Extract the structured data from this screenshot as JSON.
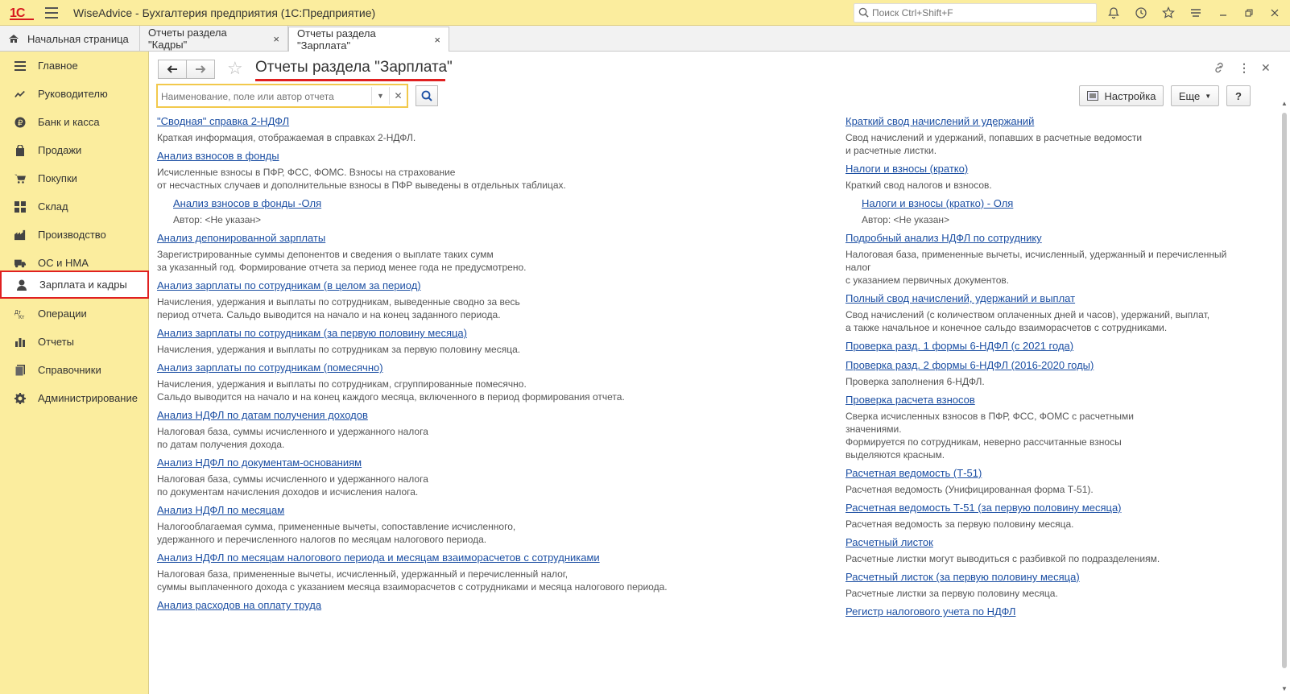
{
  "app": {
    "logo": "1С",
    "title": "WiseAdvice - Бухгалтерия предприятия  (1С:Предприятие)"
  },
  "search": {
    "placeholder": "Поиск Ctrl+Shift+F"
  },
  "tabs": [
    {
      "label": "Начальная страница"
    },
    {
      "label": "Отчеты раздела \"Кадры\"",
      "close": "×"
    },
    {
      "label": "Отчеты раздела \"Зарплата\"",
      "close": "×"
    }
  ],
  "sidebar": {
    "items": [
      {
        "label": "Главное",
        "icon": "menu-icon"
      },
      {
        "label": "Руководителю",
        "icon": "trend-icon"
      },
      {
        "label": "Банк и касса",
        "icon": "ruble-icon"
      },
      {
        "label": "Продажи",
        "icon": "bag-icon"
      },
      {
        "label": "Покупки",
        "icon": "cart-icon"
      },
      {
        "label": "Склад",
        "icon": "grid-icon"
      },
      {
        "label": "Производство",
        "icon": "factory-icon"
      },
      {
        "label": "ОС и НМА",
        "icon": "truck-icon"
      },
      {
        "label": "Зарплата и кадры",
        "icon": "person-icon",
        "active": true
      },
      {
        "label": "Операции",
        "icon": "operations-icon"
      },
      {
        "label": "Отчеты",
        "icon": "barchart-icon"
      },
      {
        "label": "Справочники",
        "icon": "book-icon"
      },
      {
        "label": "Администрирование",
        "icon": "gear-icon"
      }
    ]
  },
  "main": {
    "title": "Отчеты раздела \"Зарплата\"",
    "filter_placeholder": "Наименование, поле или автор отчета",
    "settings_label": "Настройка",
    "more_label": "Еще",
    "help_label": "?",
    "left": [
      {
        "link": "\"Сводная\" справка 2-НДФЛ",
        "desc": "Краткая информация, отображаемая в справках 2-НДФЛ."
      },
      {
        "link": "Анализ взносов в фонды",
        "desc": "Исчисленные взносы в ПФР, ФСС, ФОМС. Взносы на страхование\nот несчастных случаев и дополнительные взносы в ПФР выведены в отдельных таблицах."
      },
      {
        "link": "Анализ взносов в фонды -Оля",
        "desc": "Автор: <Не указан>",
        "sub": true
      },
      {
        "link": "Анализ депонированной зарплаты",
        "desc": "Зарегистрированные суммы депонентов и сведения о выплате таких сумм\nза указанный год. Формирование отчета за период менее года не предусмотрено."
      },
      {
        "link": "Анализ зарплаты по сотрудникам (в целом за период)",
        "desc": "Начисления, удержания и выплаты по сотрудникам, выведенные сводно за весь\nпериод отчета. Сальдо выводится на начало и на конец заданного периода."
      },
      {
        "link": "Анализ зарплаты по сотрудникам (за первую половину месяца)",
        "desc": "Начисления, удержания и выплаты по сотрудникам за первую половину месяца."
      },
      {
        "link": "Анализ зарплаты по сотрудникам (помесячно)",
        "desc": "Начисления, удержания и выплаты по сотрудникам, сгруппированные помесячно.\nСальдо выводится на начало и на конец каждого месяца, включенного в период формирования отчета."
      },
      {
        "link": "Анализ НДФЛ по датам получения доходов",
        "desc": "Налоговая база, суммы исчисленного и удержанного налога\nпо датам получения дохода."
      },
      {
        "link": "Анализ НДФЛ по документам-основаниям",
        "desc": "Налоговая база, суммы исчисленного и удержанного налога\nпо документам начисления доходов и исчисления налога."
      },
      {
        "link": "Анализ НДФЛ по месяцам",
        "desc": "Налогооблагаемая сумма, примененные вычеты, сопоставление исчисленного,\nудержанного и перечисленного налогов по месяцам налогового периода."
      },
      {
        "link": "Анализ НДФЛ по месяцам налогового периода и месяцам взаиморасчетов с сотрудниками",
        "desc": "Налоговая база, примененные вычеты, исчисленный, удержанный и перечисленный налог,\nсуммы выплаченного дохода с указанием месяца взаиморасчетов с сотрудниками и месяца налогового периода."
      },
      {
        "link": "Анализ расходов на оплату труда",
        "desc": ""
      }
    ],
    "right": [
      {
        "link": "Краткий свод начислений и удержаний",
        "desc": "Свод начислений и удержаний, попавших в расчетные ведомости\nи расчетные листки."
      },
      {
        "link": "Налоги и взносы (кратко)",
        "desc": "Краткий свод налогов и взносов."
      },
      {
        "link": "Налоги и взносы (кратко) - Оля",
        "desc": "Автор: <Не указан>",
        "sub": true
      },
      {
        "link": "Подробный анализ НДФЛ по сотруднику",
        "desc": "Налоговая база, примененные вычеты, исчисленный, удержанный и перечисленный\nналог\nс указанием первичных документов."
      },
      {
        "link": "Полный свод начислений, удержаний и выплат",
        "desc": "Свод начислений (с количеством оплаченных дней и часов), удержаний, выплат,\nа также начальное и конечное сальдо взаиморасчетов с сотрудниками."
      },
      {
        "link": "Проверка разд. 1 формы 6-НДФЛ (с 2021 года)",
        "desc": ""
      },
      {
        "link": "Проверка разд. 2 формы 6-НДФЛ (2016-2020 годы)",
        "desc": "Проверка заполнения 6-НДФЛ."
      },
      {
        "link": "Проверка расчета взносов",
        "desc": "Сверка исчисленных взносов в ПФР, ФСС, ФОМС с расчетными\nзначениями.\nФормируется по сотрудникам, неверно рассчитанные взносы\nвыделяются красным."
      },
      {
        "link": "Расчетная ведомость (Т-51)",
        "desc": "Расчетная ведомость (Унифицированная форма Т-51)."
      },
      {
        "link": "Расчетная ведомость Т-51 (за первую половину месяца)",
        "desc": "Расчетная ведомость за первую половину месяца."
      },
      {
        "link": "Расчетный листок",
        "desc": "Расчетные листки могут выводиться с разбивкой по подразделениям."
      },
      {
        "link": "Расчетный листок (за первую половину месяца)",
        "desc": "Расчетные листки за первую половину месяца."
      },
      {
        "link": "Регистр налогового учета по НДФЛ",
        "desc": ""
      }
    ]
  },
  "colors": {
    "accent": "#fbed9e",
    "link": "#1c4fa3",
    "highlight": "#e02020"
  }
}
